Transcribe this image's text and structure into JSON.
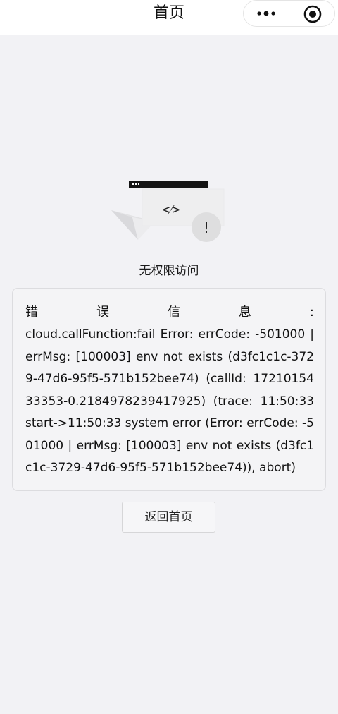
{
  "nav": {
    "title": "首页",
    "more_icon": "more-dots-icon",
    "close_icon": "close-circle-icon"
  },
  "illustration": {
    "code_symbol": "<⁄>",
    "alert_symbol": "!"
  },
  "status": {
    "text": "无权限访问"
  },
  "error": {
    "label_chars": [
      "错",
      "误",
      "信",
      "息",
      ":"
    ],
    "message": "cloud.callFunction:fail Error: errCode: -501000 | errMsg: [100003] env not exists (d3fc1c1c-3729-47d6-95f5-571b152bee74) (callId: 1721015433353-0.2184978239417925) (trace: 11:50:33 start->11:50:33 system error (Error: errCode: -501000 | errMsg: [100003] env not exists (d3fc1c1c-3729-47d6-95f5-571b152bee74)), abort)"
  },
  "actions": {
    "back_label": "返回首页"
  },
  "colors": {
    "page_background": "#f2f2f5",
    "nav_background": "#ffffff",
    "text": "#111111"
  }
}
